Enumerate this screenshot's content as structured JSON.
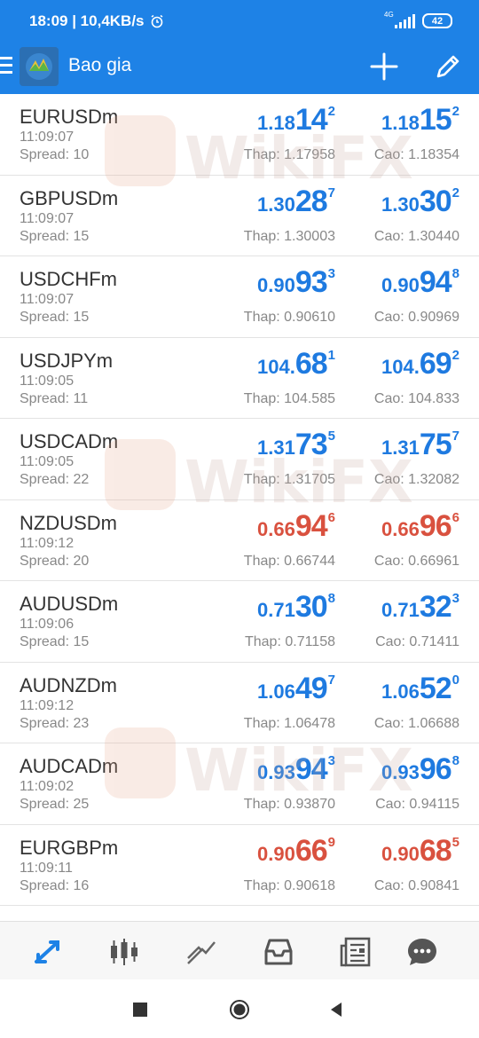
{
  "status_bar": {
    "time_speed": "18:09 | 10,4KB/s",
    "network": "4G",
    "battery": "42"
  },
  "app_bar": {
    "title": "Bao gia"
  },
  "labels": {
    "spread_prefix": "Spread: ",
    "low_prefix": "Thap: ",
    "high_prefix": "Cao: "
  },
  "quotes": [
    {
      "symbol": "EURUSDm",
      "time": "11:09:07",
      "spread": "10",
      "bid": [
        "1.18",
        "14",
        "2"
      ],
      "ask": [
        "1.18",
        "15",
        "2"
      ],
      "low": "1.17958",
      "high": "1.18354",
      "color": "blue"
    },
    {
      "symbol": "GBPUSDm",
      "time": "11:09:07",
      "spread": "15",
      "bid": [
        "1.30",
        "28",
        "7"
      ],
      "ask": [
        "1.30",
        "30",
        "2"
      ],
      "low": "1.30003",
      "high": "1.30440",
      "color": "blue"
    },
    {
      "symbol": "USDCHFm",
      "time": "11:09:07",
      "spread": "15",
      "bid": [
        "0.90",
        "93",
        "3"
      ],
      "ask": [
        "0.90",
        "94",
        "8"
      ],
      "low": "0.90610",
      "high": "0.90969",
      "color": "blue"
    },
    {
      "symbol": "USDJPYm",
      "time": "11:09:05",
      "spread": "11",
      "bid": [
        "104.",
        "68",
        "1"
      ],
      "ask": [
        "104.",
        "69",
        "2"
      ],
      "low": "104.585",
      "high": "104.833",
      "color": "blue"
    },
    {
      "symbol": "USDCADm",
      "time": "11:09:05",
      "spread": "22",
      "bid": [
        "1.31",
        "73",
        "5"
      ],
      "ask": [
        "1.31",
        "75",
        "7"
      ],
      "low": "1.31705",
      "high": "1.32082",
      "color": "blue"
    },
    {
      "symbol": "NZDUSDm",
      "time": "11:09:12",
      "spread": "20",
      "bid": [
        "0.66",
        "94",
        "6"
      ],
      "ask": [
        "0.66",
        "96",
        "6"
      ],
      "low": "0.66744",
      "high": "0.66961",
      "color": "red"
    },
    {
      "symbol": "AUDUSDm",
      "time": "11:09:06",
      "spread": "15",
      "bid": [
        "0.71",
        "30",
        "8"
      ],
      "ask": [
        "0.71",
        "32",
        "3"
      ],
      "low": "0.71158",
      "high": "0.71411",
      "color": "blue"
    },
    {
      "symbol": "AUDNZDm",
      "time": "11:09:12",
      "spread": "23",
      "bid": [
        "1.06",
        "49",
        "7"
      ],
      "ask": [
        "1.06",
        "52",
        "0"
      ],
      "low": "1.06478",
      "high": "1.06688",
      "color": "blue"
    },
    {
      "symbol": "AUDCADm",
      "time": "11:09:02",
      "spread": "25",
      "bid": [
        "0.93",
        "94",
        "3"
      ],
      "ask": [
        "0.93",
        "96",
        "8"
      ],
      "low": "0.93870",
      "high": "0.94115",
      "color": "blue"
    },
    {
      "symbol": "EURGBPm",
      "time": "11:09:11",
      "spread": "16",
      "bid": [
        "0.90",
        "66",
        "9"
      ],
      "ask": [
        "0.90",
        "68",
        "5"
      ],
      "low": "0.90618",
      "high": "0.90841",
      "color": "red"
    }
  ],
  "watermark": "WikiFX",
  "tabs": [
    {
      "icon": "quotes-icon",
      "active": true
    },
    {
      "icon": "chart-icon",
      "active": false
    },
    {
      "icon": "trade-icon",
      "active": false
    },
    {
      "icon": "history-icon",
      "active": false
    },
    {
      "icon": "news-icon",
      "active": false
    },
    {
      "icon": "chat-icon",
      "active": false
    }
  ],
  "colors": {
    "accent": "#1e82e6",
    "price_up": "#1e7ae0",
    "price_down": "#d9513f"
  }
}
